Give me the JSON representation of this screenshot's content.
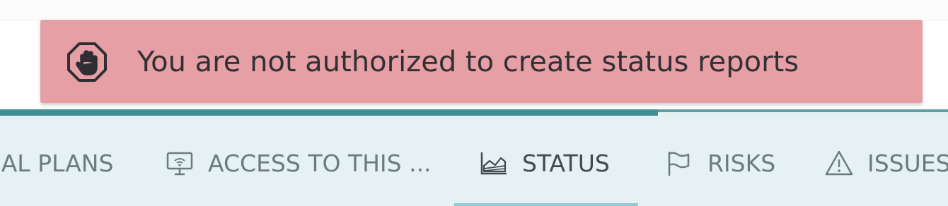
{
  "alert": {
    "icon": "hand-stop-icon",
    "message": "You are not authorized to create status reports",
    "color": "#e79fa6"
  },
  "tabs": [
    {
      "id": "plans",
      "label": "IAL PLANS",
      "icon": null,
      "active": false
    },
    {
      "id": "access",
      "label": "ACCESS TO THIS ...",
      "icon": "presentation-icon",
      "active": false
    },
    {
      "id": "status",
      "label": "STATUS",
      "icon": "area-chart-icon",
      "active": true
    },
    {
      "id": "risks",
      "label": "RISKS",
      "icon": "flag-icon",
      "active": false
    },
    {
      "id": "issues",
      "label": "ISSUES",
      "icon": "warning-icon",
      "active": false
    }
  ],
  "colors": {
    "tabbar_bg": "#e5f1f3",
    "accent": "#3e8f96"
  }
}
